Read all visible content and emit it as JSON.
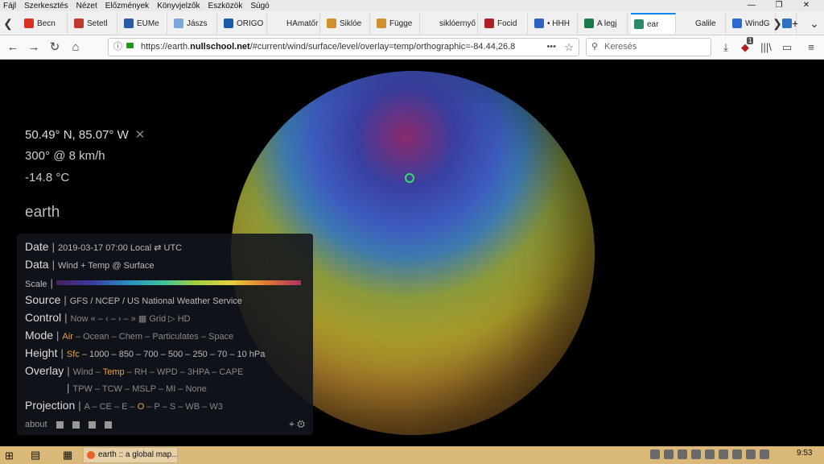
{
  "menu": [
    "Fájl",
    "Szerkesztés",
    "Nézet",
    "Előzmények",
    "Könyvjelzők",
    "Eszközök",
    "Súgó"
  ],
  "window_controls": {
    "minimize": "—",
    "maximize": "❐",
    "close": "✕"
  },
  "tabs": [
    {
      "label": "Becn",
      "color": "#d93025"
    },
    {
      "label": "Setetl",
      "color": "#c0392b"
    },
    {
      "label": "EUMe",
      "color": "#2a5aa8"
    },
    {
      "label": "Jászs",
      "color": "#7aa8d8"
    },
    {
      "label": "ORIGO",
      "color": "#1a5aa8"
    },
    {
      "label": "HAmatőr",
      "color": "#f0f0f0"
    },
    {
      "label": "Siklóe",
      "color": "#d09030"
    },
    {
      "label": "Függe",
      "color": "#d09030"
    },
    {
      "label": "siklóernyő",
      "color": "#f0f0f0"
    },
    {
      "label": "Focid",
      "color": "#b02020"
    },
    {
      "label": "• HHH",
      "color": "#3060c0"
    },
    {
      "label": "A legj",
      "color": "#1a7a4a"
    },
    {
      "label": "ear",
      "color": "#2a8a6a"
    },
    {
      "label": "Galile",
      "color": "#f0f0f0"
    },
    {
      "label": "WindG",
      "color": "#2a6ad0"
    },
    {
      "label": "C",
      "color": "#3070c0"
    }
  ],
  "tabnav": {
    "left": "❮",
    "right": "❯",
    "new": "+",
    "list": "⌄"
  },
  "nav": {
    "back": "←",
    "forward": "→",
    "reload": "↻",
    "home": "⌂"
  },
  "url": {
    "prefix": "https://earth.",
    "host": "nullschool.net",
    "path": "/#current/wind/surface/level/overlay=temp/orthographic=-84.44,26.8",
    "info": "ⓘ",
    "dots": "•••",
    "star": "☆"
  },
  "search": {
    "placeholder": "Keresés",
    "icon": "⚲"
  },
  "toolbar_right": {
    "download": "⤓",
    "badge": "1",
    "library": "|||\\",
    "sidebar": "▭",
    "menu": "≡"
  },
  "earth": {
    "coords": "50.49° N, 85.07° W",
    "close": "✕",
    "wind": "300° @ 8 km/h",
    "temp": "-14.8 °C",
    "brand": "earth"
  },
  "panel": {
    "date_label": "Date",
    "date_value": "2019-03-17 07:00 Local ⇄ UTC",
    "data_label": "Data",
    "data_value": "Wind + Temp @ Surface",
    "scale_label": "Scale",
    "source_label": "Source",
    "source_value": "GFS / NCEP / US National Weather Service",
    "control_label": "Control",
    "control_value": "Now « – ‹ – › – » ▦ Grid ▷ HD",
    "mode_label": "Mode",
    "mode_on": "Air",
    "mode_rest": " – Ocean – Chem – Particulates – Space",
    "height_label": "Height",
    "height_on": "Sfc",
    "height_rest": " – 1000 – 850 – 700 – 500 – 250 – 70 – 10 hPa",
    "overlay_label": "Overlay",
    "overlay_a": "Wind – ",
    "overlay_on": "Temp",
    "overlay_b": " – RH – WPD – 3HPA – CAPE",
    "overlay2": "TPW – TCW – MSLP – MI – None",
    "projection_label": "Projection",
    "proj_a": "A – CE – E – ",
    "proj_on": "O",
    "proj_b": " – P – S – WB – W3",
    "about": "about"
  },
  "taskbar": {
    "app_label": "earth :: a global map...",
    "time": "9:53"
  }
}
